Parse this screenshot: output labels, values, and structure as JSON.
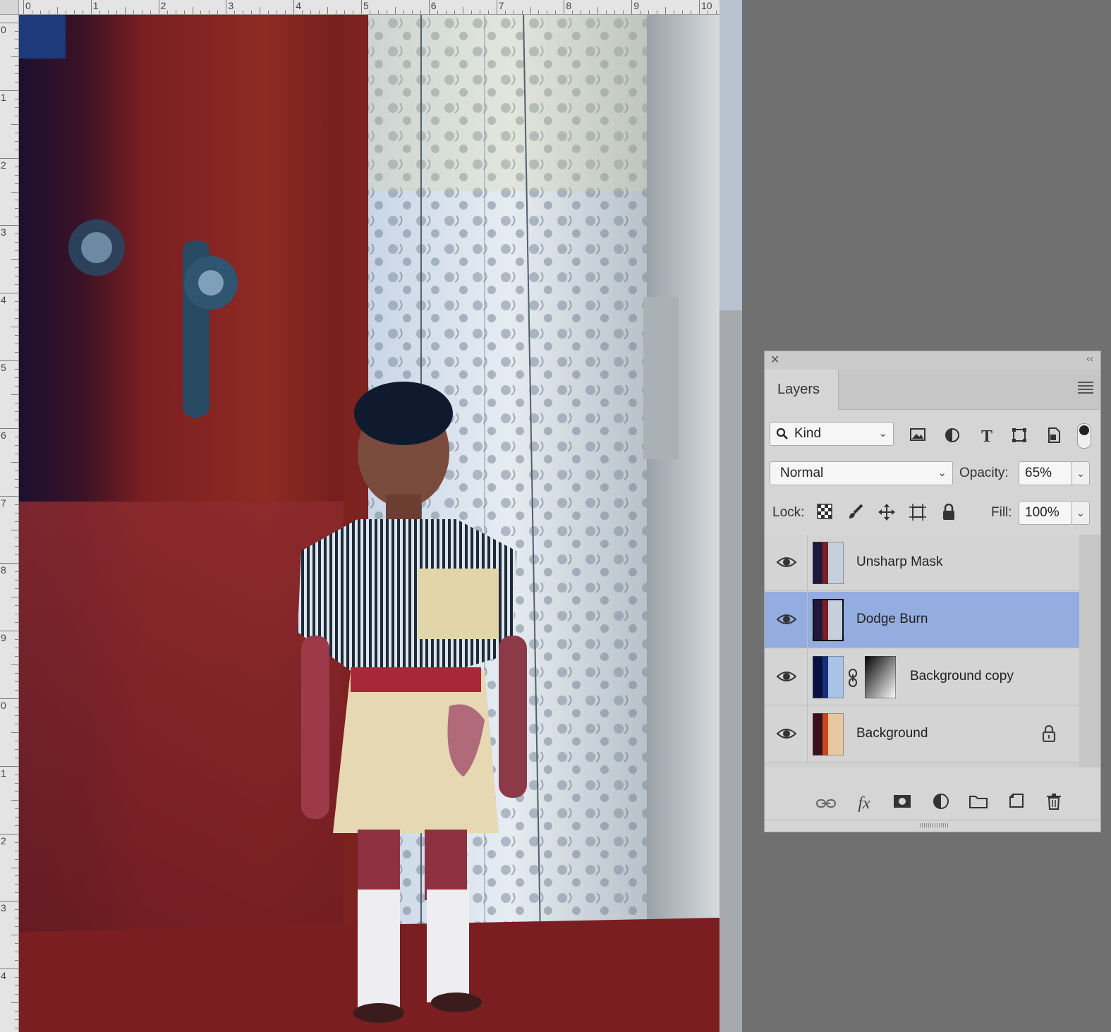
{
  "rulers": {
    "top_numbers": [
      "0",
      "1",
      "2",
      "3",
      "4",
      "5",
      "6",
      "7",
      "8",
      "9",
      "10"
    ],
    "left_numbers": [
      "0",
      "1",
      "2",
      "3",
      "4",
      "5",
      "6",
      "7",
      "8",
      "9",
      "0",
      "1",
      "2",
      "3",
      "4"
    ]
  },
  "canvas": {
    "image": "scanned photo of a child standing by a red door and a floral curtain"
  },
  "layers_panel": {
    "tab_label": "Layers",
    "filter": {
      "kind_label": "Kind"
    },
    "blend_mode": "Normal",
    "opacity_label": "Opacity:",
    "opacity_value": "65%",
    "lock_label": "Lock:",
    "fill_label": "Fill:",
    "fill_value": "100%",
    "layers": [
      {
        "name": "Unsharp Mask",
        "visible": true,
        "selected": false,
        "has_mask": false,
        "locked": false
      },
      {
        "name": "Dodge Burn",
        "visible": true,
        "selected": true,
        "has_mask": false,
        "locked": false
      },
      {
        "name": "Background copy",
        "visible": true,
        "selected": false,
        "has_mask": true,
        "locked": false
      },
      {
        "name": "Background",
        "visible": true,
        "selected": false,
        "has_mask": false,
        "locked": true
      }
    ],
    "colors": {
      "selected_row": "#94ade0",
      "panel_bg": "#d5d5d5"
    }
  }
}
